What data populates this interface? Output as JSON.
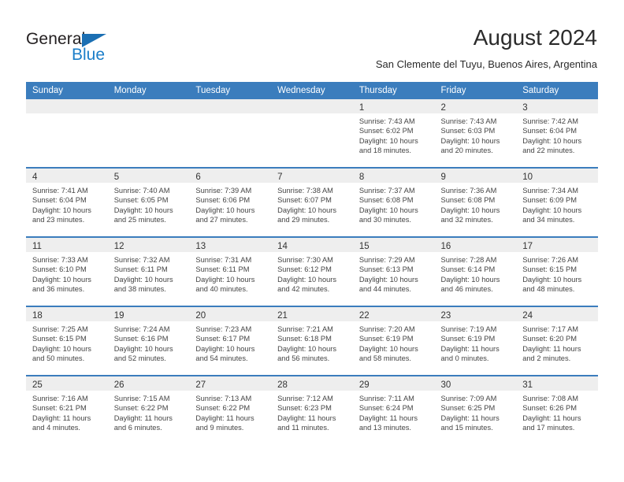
{
  "brand": {
    "name_dark": "General",
    "name_blue": "Blue",
    "accent_color": "#1b7ec9",
    "header_color": "#3b7dbd"
  },
  "header": {
    "title": "August 2024",
    "location": "San Clemente del Tuyu, Buenos Aires, Argentina"
  },
  "calendar": {
    "weekday_headers": [
      "Sunday",
      "Monday",
      "Tuesday",
      "Wednesday",
      "Thursday",
      "Friday",
      "Saturday"
    ],
    "weeks": [
      [
        {
          "day": "",
          "sunrise": "",
          "sunset": "",
          "daylight1": "",
          "daylight2": "",
          "empty": true
        },
        {
          "day": "",
          "sunrise": "",
          "sunset": "",
          "daylight1": "",
          "daylight2": "",
          "empty": true
        },
        {
          "day": "",
          "sunrise": "",
          "sunset": "",
          "daylight1": "",
          "daylight2": "",
          "empty": true
        },
        {
          "day": "",
          "sunrise": "",
          "sunset": "",
          "daylight1": "",
          "daylight2": "",
          "empty": true
        },
        {
          "day": "1",
          "sunrise": "Sunrise: 7:43 AM",
          "sunset": "Sunset: 6:02 PM",
          "daylight1": "Daylight: 10 hours",
          "daylight2": "and 18 minutes."
        },
        {
          "day": "2",
          "sunrise": "Sunrise: 7:43 AM",
          "sunset": "Sunset: 6:03 PM",
          "daylight1": "Daylight: 10 hours",
          "daylight2": "and 20 minutes."
        },
        {
          "day": "3",
          "sunrise": "Sunrise: 7:42 AM",
          "sunset": "Sunset: 6:04 PM",
          "daylight1": "Daylight: 10 hours",
          "daylight2": "and 22 minutes."
        }
      ],
      [
        {
          "day": "4",
          "sunrise": "Sunrise: 7:41 AM",
          "sunset": "Sunset: 6:04 PM",
          "daylight1": "Daylight: 10 hours",
          "daylight2": "and 23 minutes."
        },
        {
          "day": "5",
          "sunrise": "Sunrise: 7:40 AM",
          "sunset": "Sunset: 6:05 PM",
          "daylight1": "Daylight: 10 hours",
          "daylight2": "and 25 minutes."
        },
        {
          "day": "6",
          "sunrise": "Sunrise: 7:39 AM",
          "sunset": "Sunset: 6:06 PM",
          "daylight1": "Daylight: 10 hours",
          "daylight2": "and 27 minutes."
        },
        {
          "day": "7",
          "sunrise": "Sunrise: 7:38 AM",
          "sunset": "Sunset: 6:07 PM",
          "daylight1": "Daylight: 10 hours",
          "daylight2": "and 29 minutes."
        },
        {
          "day": "8",
          "sunrise": "Sunrise: 7:37 AM",
          "sunset": "Sunset: 6:08 PM",
          "daylight1": "Daylight: 10 hours",
          "daylight2": "and 30 minutes."
        },
        {
          "day": "9",
          "sunrise": "Sunrise: 7:36 AM",
          "sunset": "Sunset: 6:08 PM",
          "daylight1": "Daylight: 10 hours",
          "daylight2": "and 32 minutes."
        },
        {
          "day": "10",
          "sunrise": "Sunrise: 7:34 AM",
          "sunset": "Sunset: 6:09 PM",
          "daylight1": "Daylight: 10 hours",
          "daylight2": "and 34 minutes."
        }
      ],
      [
        {
          "day": "11",
          "sunrise": "Sunrise: 7:33 AM",
          "sunset": "Sunset: 6:10 PM",
          "daylight1": "Daylight: 10 hours",
          "daylight2": "and 36 minutes."
        },
        {
          "day": "12",
          "sunrise": "Sunrise: 7:32 AM",
          "sunset": "Sunset: 6:11 PM",
          "daylight1": "Daylight: 10 hours",
          "daylight2": "and 38 minutes."
        },
        {
          "day": "13",
          "sunrise": "Sunrise: 7:31 AM",
          "sunset": "Sunset: 6:11 PM",
          "daylight1": "Daylight: 10 hours",
          "daylight2": "and 40 minutes."
        },
        {
          "day": "14",
          "sunrise": "Sunrise: 7:30 AM",
          "sunset": "Sunset: 6:12 PM",
          "daylight1": "Daylight: 10 hours",
          "daylight2": "and 42 minutes."
        },
        {
          "day": "15",
          "sunrise": "Sunrise: 7:29 AM",
          "sunset": "Sunset: 6:13 PM",
          "daylight1": "Daylight: 10 hours",
          "daylight2": "and 44 minutes."
        },
        {
          "day": "16",
          "sunrise": "Sunrise: 7:28 AM",
          "sunset": "Sunset: 6:14 PM",
          "daylight1": "Daylight: 10 hours",
          "daylight2": "and 46 minutes."
        },
        {
          "day": "17",
          "sunrise": "Sunrise: 7:26 AM",
          "sunset": "Sunset: 6:15 PM",
          "daylight1": "Daylight: 10 hours",
          "daylight2": "and 48 minutes."
        }
      ],
      [
        {
          "day": "18",
          "sunrise": "Sunrise: 7:25 AM",
          "sunset": "Sunset: 6:15 PM",
          "daylight1": "Daylight: 10 hours",
          "daylight2": "and 50 minutes."
        },
        {
          "day": "19",
          "sunrise": "Sunrise: 7:24 AM",
          "sunset": "Sunset: 6:16 PM",
          "daylight1": "Daylight: 10 hours",
          "daylight2": "and 52 minutes."
        },
        {
          "day": "20",
          "sunrise": "Sunrise: 7:23 AM",
          "sunset": "Sunset: 6:17 PM",
          "daylight1": "Daylight: 10 hours",
          "daylight2": "and 54 minutes."
        },
        {
          "day": "21",
          "sunrise": "Sunrise: 7:21 AM",
          "sunset": "Sunset: 6:18 PM",
          "daylight1": "Daylight: 10 hours",
          "daylight2": "and 56 minutes."
        },
        {
          "day": "22",
          "sunrise": "Sunrise: 7:20 AM",
          "sunset": "Sunset: 6:19 PM",
          "daylight1": "Daylight: 10 hours",
          "daylight2": "and 58 minutes."
        },
        {
          "day": "23",
          "sunrise": "Sunrise: 7:19 AM",
          "sunset": "Sunset: 6:19 PM",
          "daylight1": "Daylight: 11 hours",
          "daylight2": "and 0 minutes."
        },
        {
          "day": "24",
          "sunrise": "Sunrise: 7:17 AM",
          "sunset": "Sunset: 6:20 PM",
          "daylight1": "Daylight: 11 hours",
          "daylight2": "and 2 minutes."
        }
      ],
      [
        {
          "day": "25",
          "sunrise": "Sunrise: 7:16 AM",
          "sunset": "Sunset: 6:21 PM",
          "daylight1": "Daylight: 11 hours",
          "daylight2": "and 4 minutes."
        },
        {
          "day": "26",
          "sunrise": "Sunrise: 7:15 AM",
          "sunset": "Sunset: 6:22 PM",
          "daylight1": "Daylight: 11 hours",
          "daylight2": "and 6 minutes."
        },
        {
          "day": "27",
          "sunrise": "Sunrise: 7:13 AM",
          "sunset": "Sunset: 6:22 PM",
          "daylight1": "Daylight: 11 hours",
          "daylight2": "and 9 minutes."
        },
        {
          "day": "28",
          "sunrise": "Sunrise: 7:12 AM",
          "sunset": "Sunset: 6:23 PM",
          "daylight1": "Daylight: 11 hours",
          "daylight2": "and 11 minutes."
        },
        {
          "day": "29",
          "sunrise": "Sunrise: 7:11 AM",
          "sunset": "Sunset: 6:24 PM",
          "daylight1": "Daylight: 11 hours",
          "daylight2": "and 13 minutes."
        },
        {
          "day": "30",
          "sunrise": "Sunrise: 7:09 AM",
          "sunset": "Sunset: 6:25 PM",
          "daylight1": "Daylight: 11 hours",
          "daylight2": "and 15 minutes."
        },
        {
          "day": "31",
          "sunrise": "Sunrise: 7:08 AM",
          "sunset": "Sunset: 6:26 PM",
          "daylight1": "Daylight: 11 hours",
          "daylight2": "and 17 minutes."
        }
      ]
    ]
  }
}
